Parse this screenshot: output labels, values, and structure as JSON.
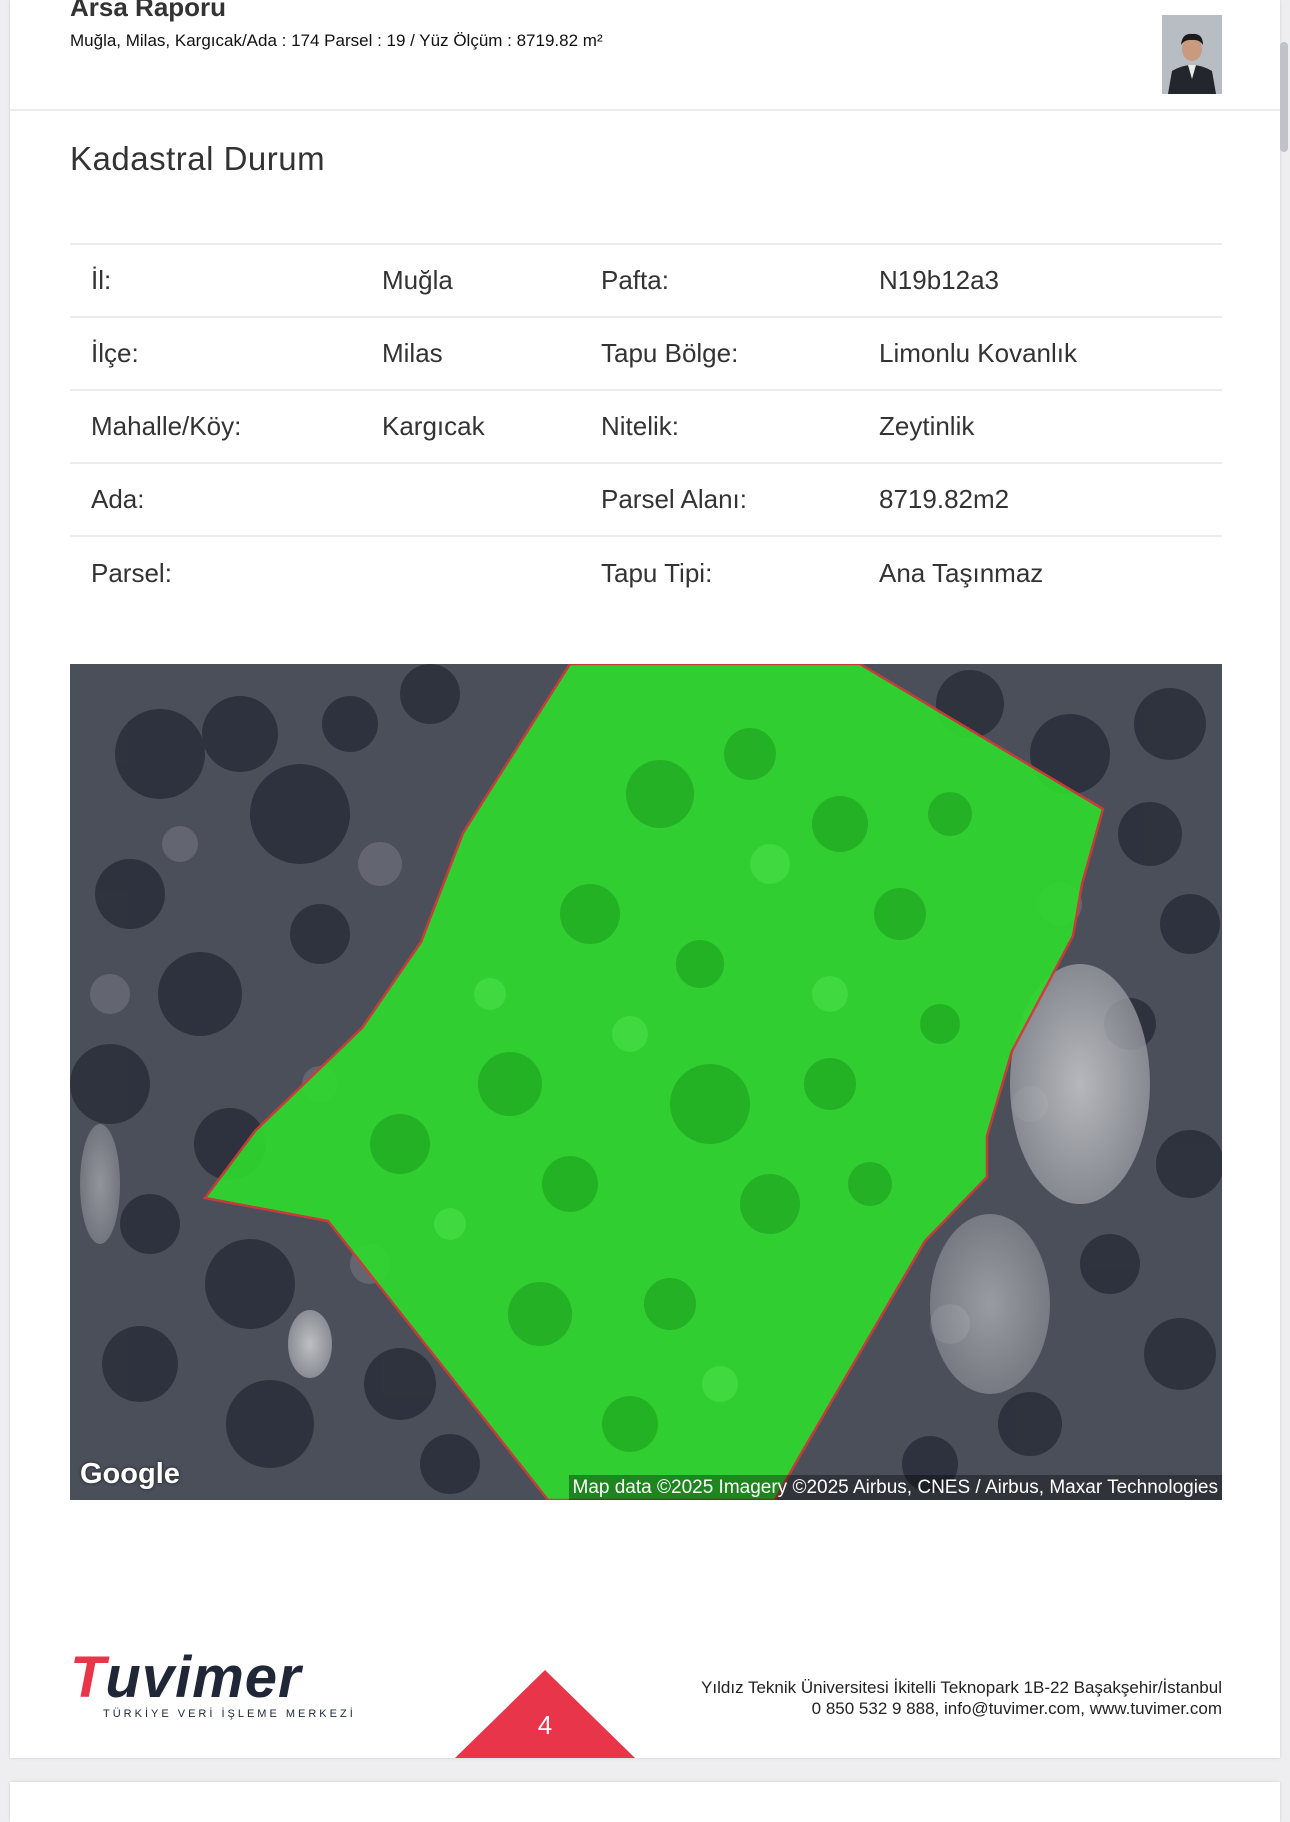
{
  "header": {
    "title": "Arsa Raporu",
    "subtitle": "Muğla, Milas, Kargıcak/Ada : 174 Parsel : 19 / Yüz Ölçüm : 8719.82 m²"
  },
  "section": {
    "title": "Kadastral Durum"
  },
  "table": {
    "rows": [
      {
        "label1": "İl:",
        "value1": "Muğla",
        "label2": "Pafta:",
        "value2": "N19b12a3"
      },
      {
        "label1": "İlçe:",
        "value1": "Milas",
        "label2": "Tapu Bölge:",
        "value2": "Limonlu Kovanlık"
      },
      {
        "label1": "Mahalle/Köy:",
        "value1": "Kargıcak",
        "label2": "Nitelik:",
        "value2": "Zeytinlik"
      },
      {
        "label1": "Ada:",
        "value1": "",
        "label2": "Parsel Alanı:",
        "value2": "8719.82m2"
      },
      {
        "label1": "Parsel:",
        "value1": "",
        "label2": "Tapu Tipi:",
        "value2": "Ana Taşınmaz"
      }
    ]
  },
  "map": {
    "provider_logo": "Google",
    "attribution": "Map data ©2025 Imagery ©2025 Airbus, CNES / Airbus, Maxar Technologies",
    "parcel_fill_color": "#2ed92e",
    "parcel_border_color": "#d23a3a"
  },
  "footer": {
    "logo_first_letter": "T",
    "logo_rest": "uvimer",
    "logo_tagline": "TÜRKİYE VERİ İŞLEME MERKEZİ",
    "page_number": "4",
    "address_line1": "Yıldız Teknik Üniversitesi İkitelli Teknopark 1B-22 Başakşehir/İstanbul",
    "address_line2": "0 850 532 9 888, info@tuvimer.com, www.tuvimer.com",
    "accent_color": "#e8354a"
  }
}
